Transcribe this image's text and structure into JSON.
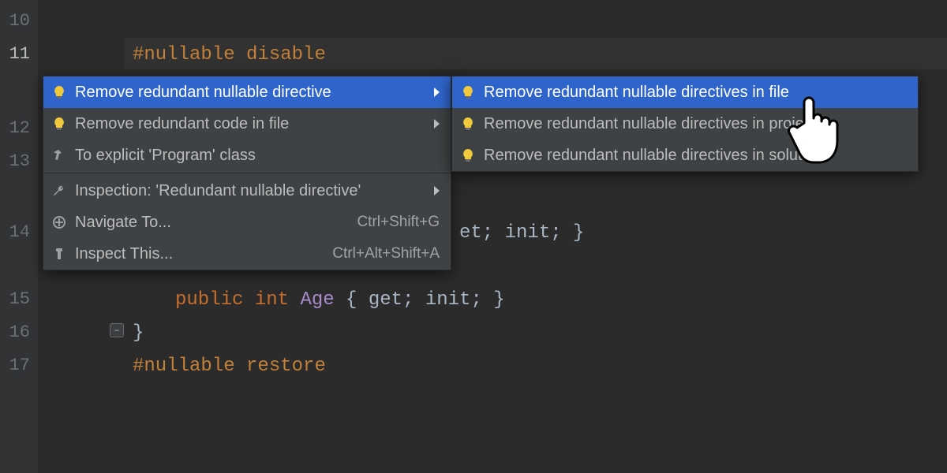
{
  "lineNumbers": {
    "l10": "10",
    "l11": "11",
    "l12": "12",
    "l13": "13",
    "l14": "14",
    "l15": "15",
    "l16": "16",
    "l17": "17"
  },
  "code": {
    "nullable_disable": "#nullable disable",
    "line14_tail": "et; init; }",
    "public": "public ",
    "int": "int ",
    "age": "Age ",
    "accessors": "{ get; init; }",
    "brace_close": "}",
    "nullable_restore": "#nullable restore"
  },
  "menu1": {
    "i0": {
      "label": "Remove redundant nullable directive"
    },
    "i1": {
      "label": "Remove redundant code in file"
    },
    "i2": {
      "label": "To explicit 'Program' class"
    },
    "i3": {
      "label": "Inspection: 'Redundant nullable directive'"
    },
    "i4": {
      "label": "Navigate To...",
      "shortcut": "Ctrl+Shift+G"
    },
    "i5": {
      "label": "Inspect This...",
      "shortcut": "Ctrl+Alt+Shift+A"
    }
  },
  "menu2": {
    "i0": {
      "label": "Remove redundant nullable directives in file"
    },
    "i1": {
      "label": "Remove redundant nullable directives in project"
    },
    "i2": {
      "label": "Remove redundant nullable directives in solution"
    }
  }
}
